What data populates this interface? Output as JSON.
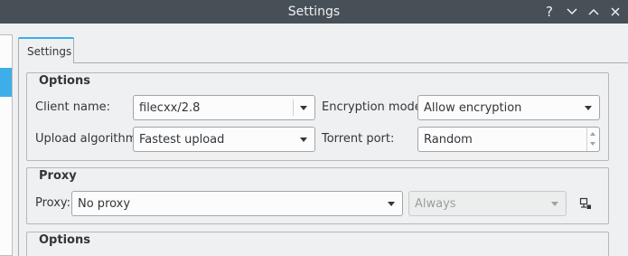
{
  "window": {
    "title": "Settings"
  },
  "tabs": [
    {
      "label": "Settings"
    }
  ],
  "options_group": {
    "title": "Options",
    "client_name_label": "Client name:",
    "client_name_value": "filecxx/2.8",
    "encryption_label": "Encryption mode:",
    "encryption_value": "Allow encryption",
    "upload_label": "Upload algorithm:",
    "upload_value": "Fastest upload",
    "torrent_port_label": "Torrent port:",
    "torrent_port_value": "Random"
  },
  "proxy_group": {
    "title": "Proxy",
    "proxy_label": "Proxy:",
    "proxy_value": "No proxy",
    "mode_value": "Always"
  },
  "options_group_2": {
    "title": "Options"
  },
  "icons": [
    "help-icon",
    "minimize-icon",
    "maximize-icon",
    "close-icon",
    "dropdown-arrow-icon",
    "proxy-settings-icon"
  ],
  "colors": {
    "titlebar": "#475057",
    "accent": "#3daee9",
    "background": "#eff0f1"
  }
}
